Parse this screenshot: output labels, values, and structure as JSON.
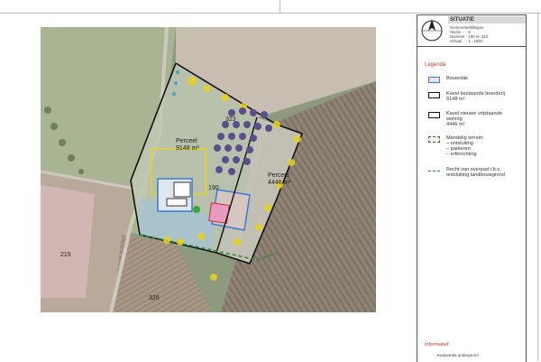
{
  "title_block": {
    "title": "SITUATIE",
    "rows": [
      {
        "key": "Gemeente",
        "value": ": Millingen"
      },
      {
        "key": "Sectie",
        "value": ": 6"
      },
      {
        "key": "Nummer",
        "value": ": 190 en 323"
      },
      {
        "key": "Schaal",
        "value": ": 1 : 1000"
      }
    ]
  },
  "legend": {
    "heading": "Legenda",
    "items": [
      {
        "label": "Bouwvlak"
      },
      {
        "label": "Kavel bestaande boerderij\n9148 m²"
      },
      {
        "label": "Kavel nieuwe vrijstaande\nwoning\n4446 m²"
      },
      {
        "label": "Mandelig terrein;\n– ontsluiting\n– parkeren\n– erfinrichting"
      },
      {
        "label": "Recht van overpad t.b.v.\nontsluiting landbouwgrond"
      }
    ]
  },
  "informatief": {
    "heading": "Informatief",
    "text": "Kadastrale ondergrond"
  },
  "map": {
    "labels": {
      "perceel_1": "Perceel\n9148 m²",
      "perceel_2": "Perceel\n4446 m²",
      "parcel_323": "323",
      "parcel_190": "190",
      "parcel_215": "215",
      "parcel_326": "326"
    }
  },
  "colors": {
    "bouwvlak": "#3a7bd5",
    "kavel_line": "#111111",
    "mandelig": "#9dc3e6",
    "overpad": "#2e8b3a",
    "title_accent": "#c0392b",
    "trees_yellow": "#e8d21a",
    "trees_purple": "#5a4e8c"
  }
}
